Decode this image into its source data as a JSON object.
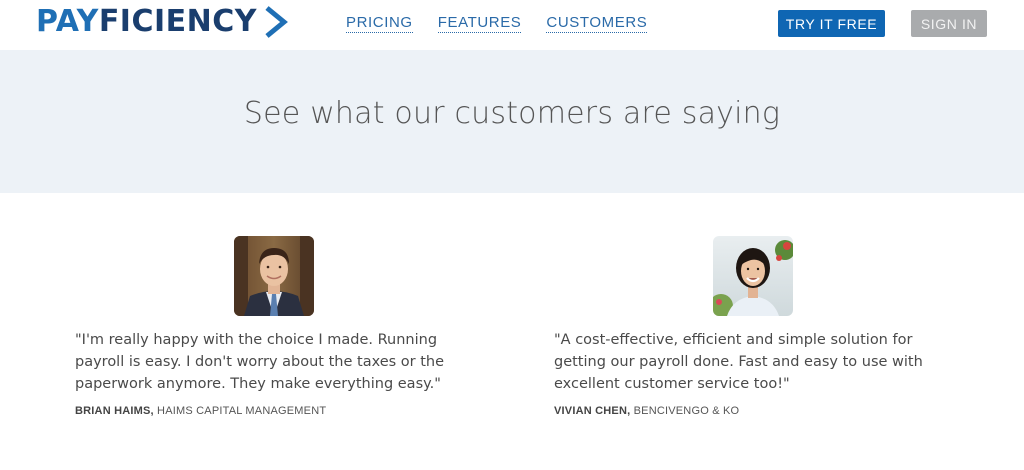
{
  "header": {
    "logo": {
      "part1": "PAY",
      "part2": "FICIENCY"
    },
    "nav": [
      {
        "label": "PRICING"
      },
      {
        "label": "FEATURES"
      },
      {
        "label": "CUSTOMERS"
      }
    ],
    "try_button": "TRY IT FREE",
    "signin_button": "SIGN IN"
  },
  "hero": {
    "title": "See what our customers are saying"
  },
  "testimonials": [
    {
      "quote": "\"I'm really happy with the choice I made. Running payroll is easy. I don't worry about the taxes or the paperwork anymore. They make everything easy.\"",
      "name": "BRIAN HAIMS,",
      "company": " HAIMS CAPITAL MANAGEMENT"
    },
    {
      "quote": "\"A cost-effective, efficient and simple solution for getting our payroll done. Fast and easy to use with excellent customer service too!\"",
      "name": "VIVIAN CHEN,",
      "company": " BENCIVENGO & KO"
    }
  ],
  "colors": {
    "brand_blue": "#1f6fb5",
    "brand_navy": "#1a3e6e",
    "primary_button": "#0f66b3",
    "secondary_button": "#a9abad",
    "hero_bg": "#edf2f7"
  }
}
